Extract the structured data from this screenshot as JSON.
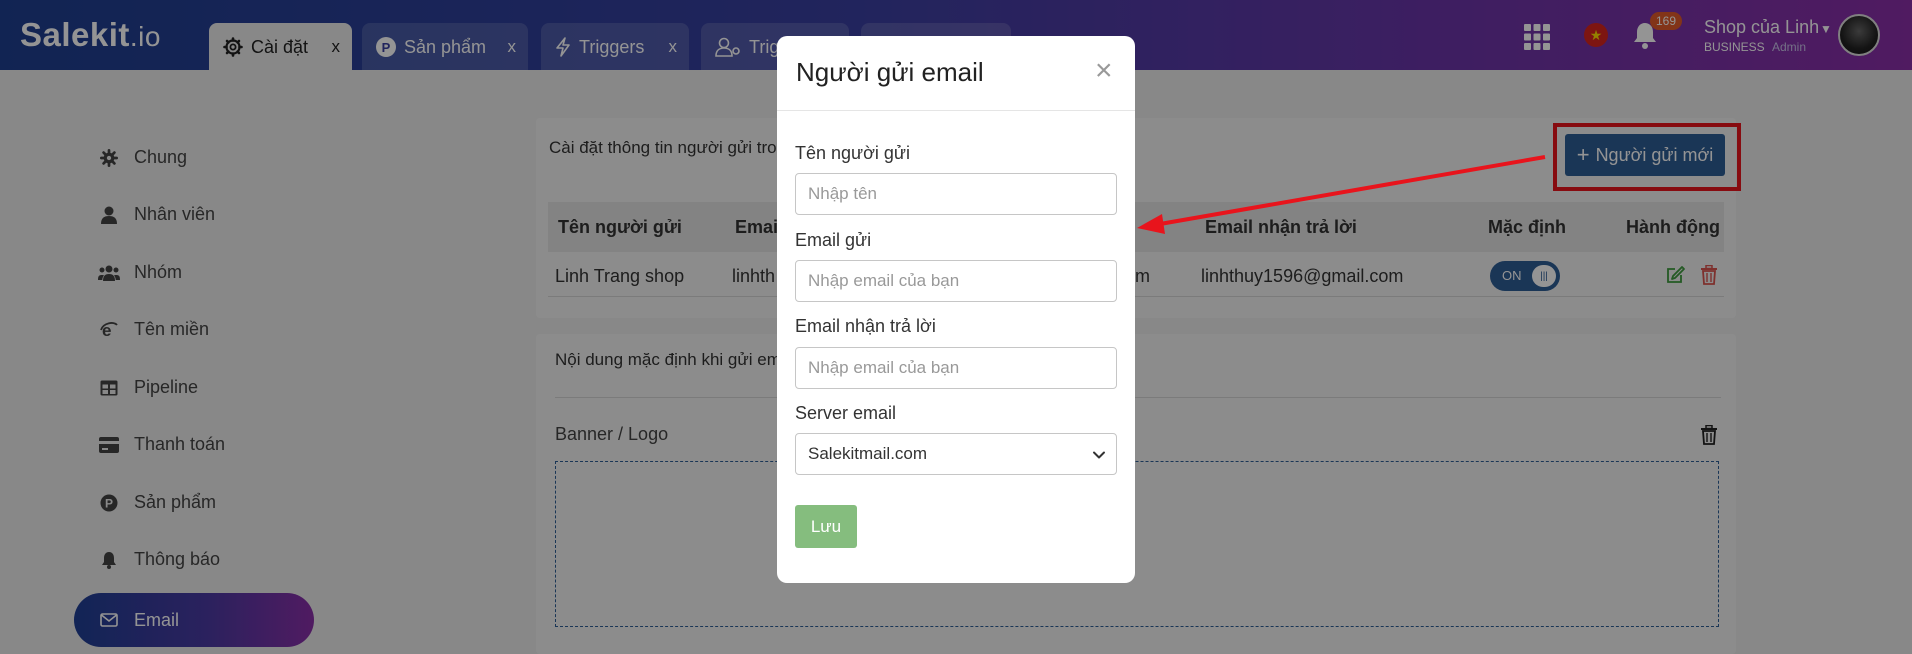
{
  "app": {
    "logo_main": "Salekit",
    "logo_suffix": ".io"
  },
  "tabs": [
    {
      "label": "Cài đặt",
      "close": "x"
    },
    {
      "label": "Sản phẩm",
      "close": "x"
    },
    {
      "label": "Triggers",
      "close": "x"
    },
    {
      "label": "Trig"
    }
  ],
  "header": {
    "notification_count": "169",
    "shop_name": "Shop của Linh",
    "plan": "BUSINESS",
    "role": "Admin"
  },
  "sidebar": {
    "items": [
      {
        "label": "Chung",
        "icon": "gear-icon"
      },
      {
        "label": "Nhân viên",
        "icon": "user-icon"
      },
      {
        "label": "Nhóm",
        "icon": "users-icon"
      },
      {
        "label": "Tên miền",
        "icon": "globe-e-icon"
      },
      {
        "label": "Pipeline",
        "icon": "table-icon"
      },
      {
        "label": "Thanh toán",
        "icon": "credit-card-icon"
      },
      {
        "label": "Sản phẩm",
        "icon": "product-p-icon"
      },
      {
        "label": "Thông báo",
        "icon": "bell-icon"
      },
      {
        "label": "Email",
        "icon": "envelope-icon",
        "active": true
      }
    ]
  },
  "main": {
    "section_title": "Cài đặt thông tin người gửi tro",
    "new_sender_button": "Người gửi mới",
    "table": {
      "headers": [
        "Tên người gửi",
        "Email",
        "Email nhận trả lời",
        "Mặc định",
        "Hành động"
      ],
      "rows": [
        {
          "sender_name": "Linh Trang shop",
          "email_visible_start": "linhth",
          "email_visible_end": "m",
          "reply_email": "linhthuy1596@gmail.com",
          "default_toggle": "ON"
        }
      ]
    },
    "default_content_title": "Nội dung mặc định khi gửi em",
    "banner_label": "Banner / Logo"
  },
  "modal": {
    "title": "Người gửi email",
    "close": "×",
    "fields": {
      "sender_name": {
        "label": "Tên người gửi",
        "placeholder": "Nhập tên"
      },
      "sender_email": {
        "label": "Email gửi",
        "placeholder": "Nhập email của bạn"
      },
      "reply_email": {
        "label": "Email nhận trả lời",
        "placeholder": "Nhập email của bạn"
      },
      "server": {
        "label": "Server email",
        "value": "Salekitmail.com"
      }
    },
    "save_button": "Lưu"
  },
  "colors": {
    "header_gradient_start": "#1e3f8f",
    "header_gradient_end": "#8a2fa8",
    "primary_button": "#2e5d95",
    "save_button": "#85bd7e",
    "annotation_red": "#e8141c"
  }
}
